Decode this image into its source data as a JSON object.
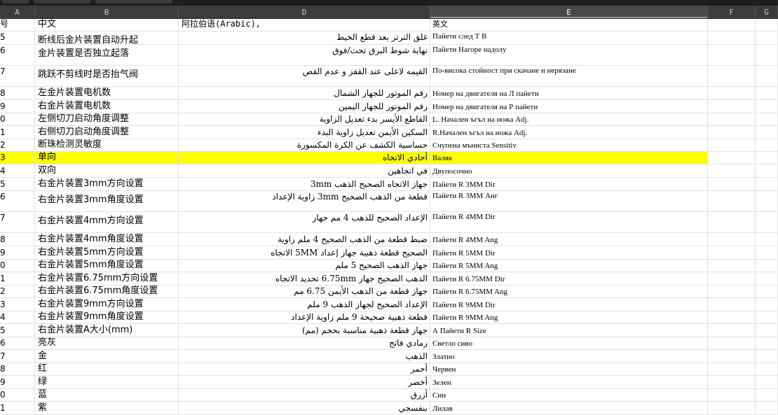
{
  "columns": [
    "A",
    "B",
    "D",
    "E",
    "F",
    "G"
  ],
  "selected_column": "E",
  "header": {
    "a": "号",
    "b": "中文",
    "d": "阿拉伯语(Arabic),",
    "e": "英文"
  },
  "rows": [
    {
      "a": "5",
      "b": "断线后金片装置自动升起",
      "d": "غلق الترتر بعد قطع الخيط",
      "e": "Пайети след Т В",
      "h": 19,
      "etop": true
    },
    {
      "a": "6",
      "b": "金片装置是否独立起落",
      "d": "نهاية شوط البرق تحت/فوق",
      "e": "Пайети Нагоре надолу",
      "h": 30,
      "etop": true
    },
    {
      "a": "7",
      "b": "跳跃不剪线时是否抬气阀",
      "d": "القيمه لاعلى عند القفز و عدم القص",
      "e": "По-висока стойност при скачане и нерязане",
      "h": 30,
      "etop": true
    },
    {
      "a": "8",
      "b": "左金片装置电机数",
      "d": "رقم الموتور للجهاز الشمال",
      "e": "Номер на двигателя на Л пайети",
      "h": 19
    },
    {
      "a": "9",
      "b": "右金片装置电机数",
      "d": "رقم الموتور للجهاز اليمين",
      "e": "Номер на двигателя на Р пайети",
      "h": 19
    },
    {
      "a": "0",
      "b": "左侧切刀启动角度调整",
      "d": "القاطع الأيسر بدء تعديل الزاوية",
      "e": "L. Начален ъгъл на ножа Adj.",
      "h": 18
    },
    {
      "a": "1",
      "b": "右侧切刀启动角度调整",
      "d": "السكين الأيمن تعديل زاوية البدء",
      "e": "R.Начален ъгъл на ножа Adj.",
      "h": 19
    },
    {
      "a": "2",
      "b": "断珠检测灵敏度",
      "d": "حساسية الكشف عن الكرة المكسورة",
      "e": "Счупена мъниста Sensitiv",
      "h": 18
    },
    {
      "a": "3",
      "b": "单向",
      "d": "أحادي الاتجاه",
      "e": "Валяк",
      "h": 18,
      "hl": true
    },
    {
      "a": "4",
      "b": "双向",
      "d": "في اتجاهين",
      "e": "Двупосочно",
      "h": 19
    },
    {
      "a": "5",
      "b": "右金片装置3mm方向设置",
      "d": "جهاز الاتجاه الصحيح الذهب 3mm",
      "e": "Пайети R 3MM Dir",
      "h": 19
    },
    {
      "a": "6",
      "b": "右金片装置3mm角度设置",
      "d": "قطعة من الذهب الصحيح 3mm زاوية الإعداد",
      "e": "Пайети R 3MM Анг",
      "h": 30,
      "etop": true
    },
    {
      "a": "7",
      "b": "右金片装置4mm方向设置",
      "d": "الإعداد الصحيح للذهب 4 مم جهاز",
      "e": "Пайети R 4MM Dir",
      "h": 30,
      "etop": true
    },
    {
      "a": "8",
      "b": "右金片装置4mm角度设置",
      "d": "ضبط قطعة من الذهب الصحيح 4 ملم زاوية",
      "e": "Пайети R 4MM Ang",
      "h": 19
    },
    {
      "a": "9",
      "b": "右金片装置5mm方向设置",
      "d": "الصحيح قطعة ذهبية جهاز إعداد 5MM الاتجاه",
      "e": "Пайети R 5MM Dir",
      "h": 19
    },
    {
      "a": "0",
      "b": "右金片装置5mm角度设置",
      "d": "جهاز الذهب الصحيح 5 ملم",
      "e": "Пайети R 5MM Ang",
      "h": 18
    },
    {
      "a": "1",
      "b": "右金片装置6.75mm方向设置",
      "d": "الذهب الصحيح جهاز 6.75mm تحديد الاتجاه",
      "e": "Пайети R 6.75MM Dir",
      "h": 19
    },
    {
      "a": "2",
      "b": "右金片装置6.75mm角度设置",
      "d": "جهاز قطعة من الذهب الأيمن 6.75 مم",
      "e": "Пайети R 6.75MM Ang",
      "h": 18
    },
    {
      "a": "3",
      "b": "右金片装置9mm方向设置",
      "d": "الإعداد الصحيح لجهاز الذهب 9 ملم",
      "e": "Пайети R 9MM Dir",
      "h": 19
    },
    {
      "a": "4",
      "b": "右金片装置9mm角度设置",
      "d": "قطعة ذهبية صحيحة 9 ملم زاوية الإعداد",
      "e": "Пайети R 9MM Ang",
      "h": 18
    },
    {
      "a": "5",
      "b": "右金片装置A大小(mm)",
      "d": "جهاز قطعة ذهبية مناسبة بحجم (مم)",
      "e": "А Пайети R Size",
      "h": 19
    },
    {
      "a": "6",
      "b": "亮灰",
      "d": "رمادي فاتح",
      "e": "Светло сиво",
      "h": 18
    },
    {
      "a": "7",
      "b": "金",
      "d": "الذهب",
      "e": "Златно",
      "h": 19
    },
    {
      "a": "8",
      "b": "红",
      "d": "أحمر",
      "e": "Червен",
      "h": 18
    },
    {
      "a": "9",
      "b": "绿",
      "d": "أخضر",
      "e": "Зелен",
      "h": 19
    },
    {
      "a": "0",
      "b": "蓝",
      "d": "أزرق",
      "e": "Син",
      "h": 18
    },
    {
      "a": "1",
      "b": "紫",
      "d": "بنفسجي",
      "e": "Лилав",
      "h": 19
    }
  ],
  "colors": {
    "highlight": "#ffff00",
    "header_bg": "#3c3c3c",
    "grid_line": "#e2e2e2"
  }
}
